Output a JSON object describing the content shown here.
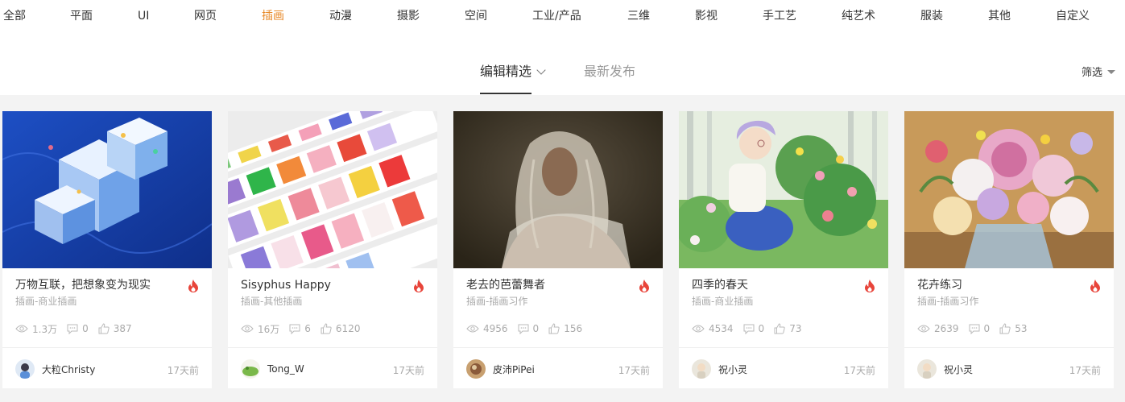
{
  "categories": [
    {
      "label": "全部",
      "active": false
    },
    {
      "label": "平面",
      "active": false
    },
    {
      "label": "UI",
      "active": false
    },
    {
      "label": "网页",
      "active": false
    },
    {
      "label": "插画",
      "active": true
    },
    {
      "label": "动漫",
      "active": false
    },
    {
      "label": "摄影",
      "active": false
    },
    {
      "label": "空间",
      "active": false
    },
    {
      "label": "工业/产品",
      "active": false
    },
    {
      "label": "三维",
      "active": false
    },
    {
      "label": "影视",
      "active": false
    },
    {
      "label": "手工艺",
      "active": false
    },
    {
      "label": "纯艺术",
      "active": false
    },
    {
      "label": "服装",
      "active": false
    },
    {
      "label": "其他",
      "active": false
    },
    {
      "label": "自定义",
      "active": false
    }
  ],
  "sort": {
    "editor_pick": "编辑精选",
    "latest": "最新发布",
    "filter": "筛选"
  },
  "accent_color": "#e88a2a",
  "cards": [
    {
      "title": "万物互联，把想象变为现实",
      "category": "插画-商业插画",
      "views": "1.3万",
      "comments": "0",
      "likes": "387",
      "author": "大粒Christy",
      "time": "17天前",
      "hot": true
    },
    {
      "title": "Sisyphus Happy",
      "category": "插画-其他插画",
      "views": "16万",
      "comments": "6",
      "likes": "6120",
      "author": "Tong_W",
      "time": "17天前",
      "hot": true
    },
    {
      "title": "老去的芭蕾舞者",
      "category": "插画-插画习作",
      "views": "4956",
      "comments": "0",
      "likes": "156",
      "author": "皮沛PiPei",
      "time": "17天前",
      "hot": true
    },
    {
      "title": "四季的春天",
      "category": "插画-商业插画",
      "views": "4534",
      "comments": "0",
      "likes": "73",
      "author": "祝小灵",
      "time": "17天前",
      "hot": true
    },
    {
      "title": "花卉练习",
      "category": "插画-插画习作",
      "views": "2639",
      "comments": "0",
      "likes": "53",
      "author": "祝小灵",
      "time": "17天前",
      "hot": true
    }
  ]
}
